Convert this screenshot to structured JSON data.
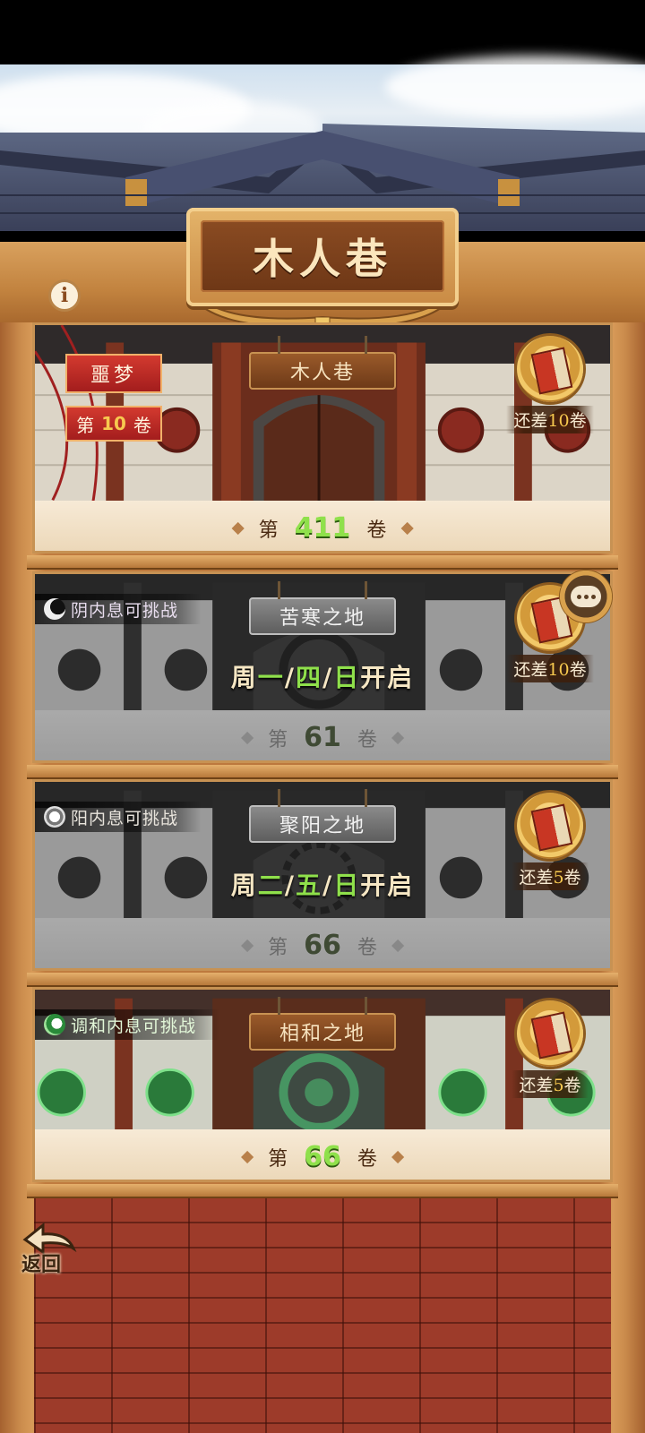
{
  "title": "木人巷",
  "info_icon": "i",
  "back_label": "返回",
  "cards": [
    {
      "name": "木人巷",
      "tag_top": "噩梦",
      "tag_bottom_prefix": "第",
      "tag_bottom_num": "10",
      "tag_bottom_suffix": "卷",
      "reward_prefix": "还差",
      "reward_num": "10",
      "reward_suffix": "卷",
      "floor_prefix": "第",
      "floor_num": "411",
      "floor_suffix": "卷"
    },
    {
      "name": "苦寒之地",
      "status": "阴内息可挑战",
      "days_prefix": "周",
      "days": [
        "一",
        "四",
        "日"
      ],
      "days_suffix": "开启",
      "reward_prefix": "还差",
      "reward_num": "10",
      "reward_suffix": "卷",
      "floor_prefix": "第",
      "floor_num": "61",
      "floor_suffix": "卷"
    },
    {
      "name": "聚阳之地",
      "status": "阳内息可挑战",
      "days_prefix": "周",
      "days": [
        "二",
        "五",
        "日"
      ],
      "days_suffix": "开启",
      "reward_prefix": "还差",
      "reward_num": "5",
      "reward_suffix": "卷",
      "floor_prefix": "第",
      "floor_num": "66",
      "floor_suffix": "卷"
    },
    {
      "name": "相和之地",
      "status": "调和内息可挑战",
      "reward_prefix": "还差",
      "reward_num": "5",
      "reward_suffix": "卷",
      "floor_prefix": "第",
      "floor_num": "66",
      "floor_suffix": "卷"
    }
  ],
  "colors": {
    "accent_green": "#8fe04b",
    "nightmare_red": "#c6262a",
    "reward_gold": "#f7c94f"
  }
}
